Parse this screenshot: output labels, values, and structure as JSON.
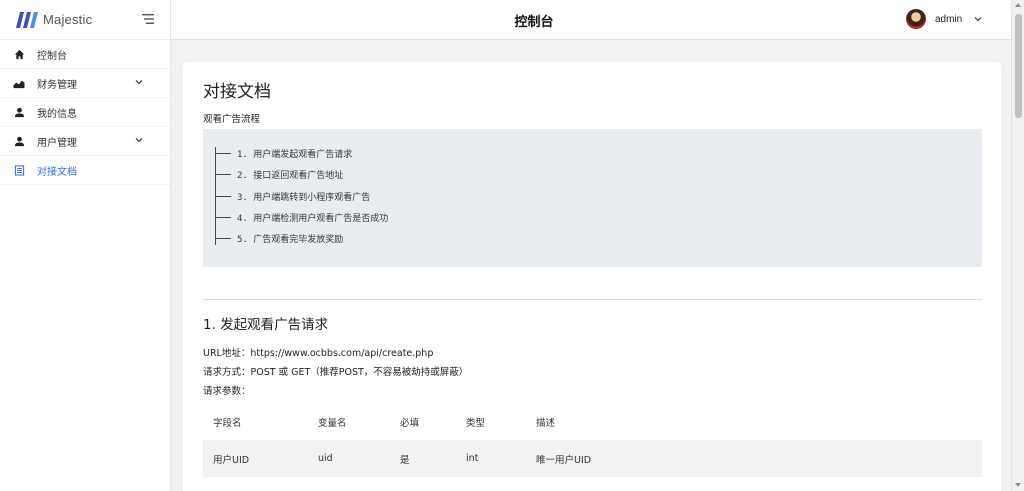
{
  "app": {
    "brand_name": "Majestic",
    "accent_color": "#2b6bf3"
  },
  "header": {
    "title": "控制台",
    "user_name": "admin"
  },
  "sidebar": {
    "items": [
      {
        "label": "控制台",
        "icon": "home-icon",
        "has_submenu": false,
        "active": false
      },
      {
        "label": "财务管理",
        "icon": "chart-area-icon",
        "has_submenu": true,
        "active": false
      },
      {
        "label": "我的信息",
        "icon": "user-icon",
        "has_submenu": false,
        "active": false
      },
      {
        "label": "用户管理",
        "icon": "user-icon",
        "has_submenu": true,
        "active": false
      },
      {
        "label": "对接文档",
        "icon": "document-icon",
        "has_submenu": false,
        "active": true
      }
    ]
  },
  "main": {
    "page_title": "对接文档",
    "flow_label": "观看广告流程",
    "flow_steps": [
      "1. 用户端发起观看广告请求",
      "2. 接口返回观看广告地址",
      "3. 用户端跳转到小程序观看广告",
      "4. 用户端检测用户观看广告是否成功",
      "5. 广告观看完毕发放奖励"
    ],
    "section_title": "1. 发起观看广告请求",
    "url_line": "URL地址：https://www.ocbbs.com/api/create.php",
    "method_line": "请求方式：POST 或 GET（推荐POST，不容易被劫持或屏蔽）",
    "params_label": "请求参数：",
    "param_table": {
      "headers": [
        "字段名",
        "变量名",
        "必填",
        "类型",
        "描述"
      ],
      "rows": [
        [
          "用户UID",
          "uid",
          "是",
          "int",
          "唯一用户UID"
        ]
      ]
    }
  }
}
